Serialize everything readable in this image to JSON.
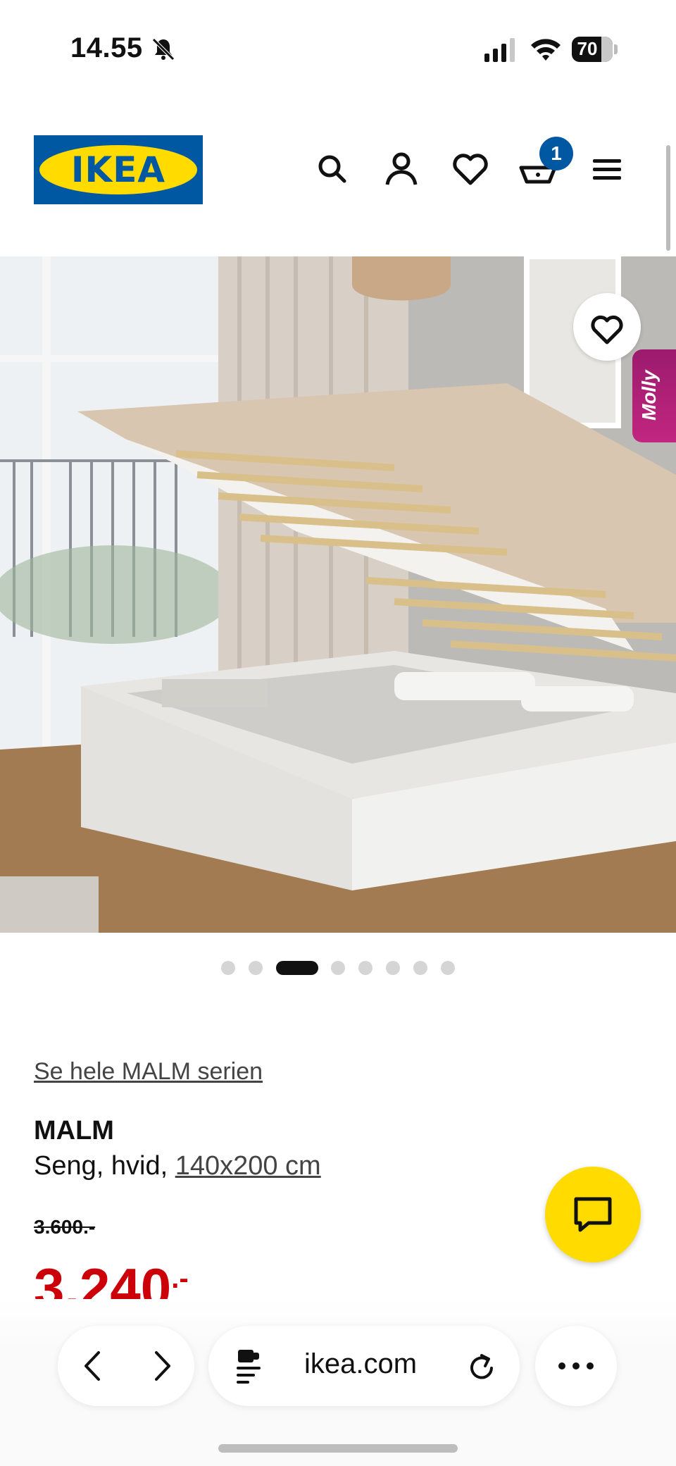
{
  "status_bar": {
    "time": "14.55",
    "battery": "70"
  },
  "header": {
    "logo_text": "IKEA",
    "cart_count": "1"
  },
  "hero": {
    "carousel_total": 8,
    "carousel_active": 3,
    "assistant_label": "Molly"
  },
  "product": {
    "series_link": "Se hele MALM serien",
    "name": "MALM",
    "desc_prefix": "Seng, hvid, ",
    "size_link": "140x200 cm",
    "old_price": "3.600.-",
    "price": "3.240",
    "price_suffix": ".-"
  },
  "browser": {
    "url": "ikea.com"
  },
  "colors": {
    "ikea_blue": "#0058a3",
    "ikea_yellow": "#ffdb00",
    "price_red": "#cc0008"
  }
}
